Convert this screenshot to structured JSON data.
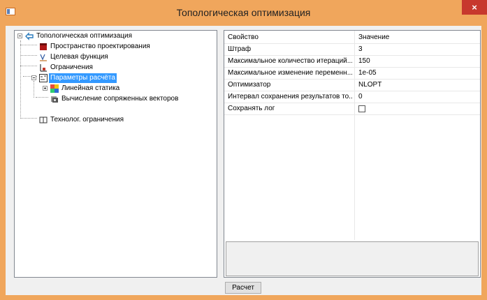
{
  "window": {
    "title": "Топологическая оптимизация",
    "close_glyph": "×",
    "accent_color": "#f0a65c"
  },
  "tree": {
    "items": [
      {
        "label": "Топологическая оптимизация",
        "icon": "optimization-icon"
      },
      {
        "label": "Пространство проектирования",
        "icon": "cube-icon"
      },
      {
        "label": "Целевая функция",
        "icon": "function-icon"
      },
      {
        "label": "Ограничения",
        "icon": "constraint-icon"
      },
      {
        "label": "Параметры расчёта",
        "icon": "params-icon",
        "selected": true
      },
      {
        "label": "Линейная статика",
        "icon": "static-icon"
      },
      {
        "label": "Вычисление сопряженных векторов",
        "icon": "vectors-icon"
      },
      {
        "label": "Технолог. ограничения",
        "icon": "tech-constraint-icon"
      }
    ]
  },
  "properties": {
    "header_name": "Свойство",
    "header_value": "Значение",
    "rows": [
      {
        "name": "Штраф",
        "value": "3"
      },
      {
        "name": "Максимальное количество итераций...",
        "value": "150"
      },
      {
        "name": "Максимальное изменение переменн...",
        "value": "1e-05"
      },
      {
        "name": "Оптимизатор",
        "value": "NLOPT"
      },
      {
        "name": "Интервал сохранения результатов то...",
        "value": "0"
      },
      {
        "name": "Сохранять лог",
        "value": ""
      }
    ]
  },
  "footer": {
    "calc_button": "Расчет"
  }
}
